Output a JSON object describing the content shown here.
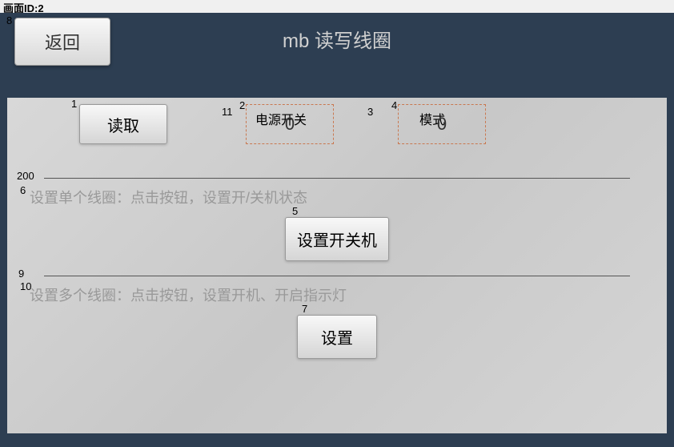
{
  "top_bar": "画面ID:2",
  "title": "mb 读写线圈",
  "back_label": "返回",
  "labels": {
    "power": "电源开关",
    "mode": "模式"
  },
  "buttons": {
    "read": "读取",
    "set_power": "设置开关机",
    "set": "设置"
  },
  "values": {
    "power": "0",
    "mode": "0"
  },
  "desc": {
    "single": "设置单个线圈：点击按钮，设置开/关机状态",
    "multi": "设置多个线圈：点击按钮，设置开机、开启指示灯"
  },
  "markers": {
    "m1": "1",
    "m2": "2",
    "m3": "3",
    "m4": "4",
    "m5": "5",
    "m6": "6",
    "m7": "7",
    "m8": "8",
    "m9": "9",
    "m10": "10",
    "m11": "11",
    "m200": "200"
  }
}
